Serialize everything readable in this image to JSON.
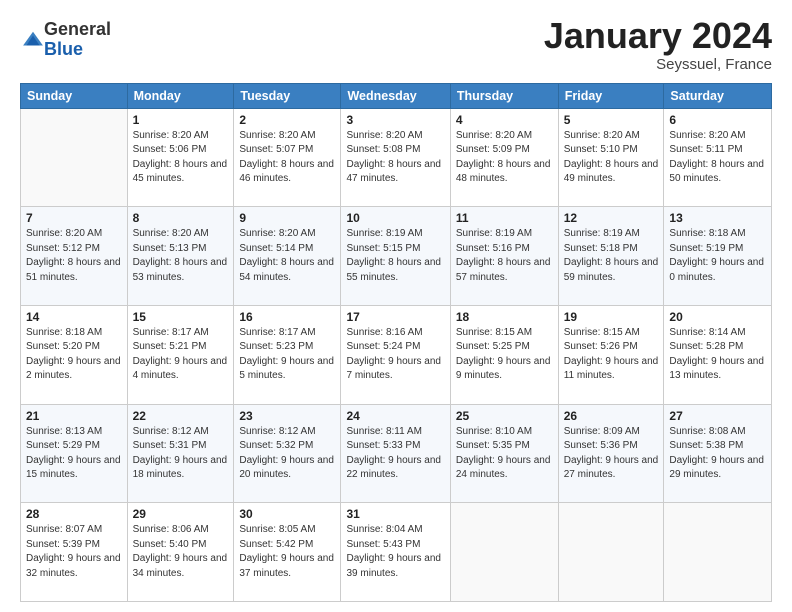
{
  "logo": {
    "general": "General",
    "blue": "Blue"
  },
  "title": "January 2024",
  "location": "Seyssuel, France",
  "days_header": [
    "Sunday",
    "Monday",
    "Tuesday",
    "Wednesday",
    "Thursday",
    "Friday",
    "Saturday"
  ],
  "weeks": [
    [
      {
        "day": "",
        "sunrise": "",
        "sunset": "",
        "daylight": ""
      },
      {
        "day": "1",
        "sunrise": "Sunrise: 8:20 AM",
        "sunset": "Sunset: 5:06 PM",
        "daylight": "Daylight: 8 hours and 45 minutes."
      },
      {
        "day": "2",
        "sunrise": "Sunrise: 8:20 AM",
        "sunset": "Sunset: 5:07 PM",
        "daylight": "Daylight: 8 hours and 46 minutes."
      },
      {
        "day": "3",
        "sunrise": "Sunrise: 8:20 AM",
        "sunset": "Sunset: 5:08 PM",
        "daylight": "Daylight: 8 hours and 47 minutes."
      },
      {
        "day": "4",
        "sunrise": "Sunrise: 8:20 AM",
        "sunset": "Sunset: 5:09 PM",
        "daylight": "Daylight: 8 hours and 48 minutes."
      },
      {
        "day": "5",
        "sunrise": "Sunrise: 8:20 AM",
        "sunset": "Sunset: 5:10 PM",
        "daylight": "Daylight: 8 hours and 49 minutes."
      },
      {
        "day": "6",
        "sunrise": "Sunrise: 8:20 AM",
        "sunset": "Sunset: 5:11 PM",
        "daylight": "Daylight: 8 hours and 50 minutes."
      }
    ],
    [
      {
        "day": "7",
        "sunrise": "Sunrise: 8:20 AM",
        "sunset": "Sunset: 5:12 PM",
        "daylight": "Daylight: 8 hours and 51 minutes."
      },
      {
        "day": "8",
        "sunrise": "Sunrise: 8:20 AM",
        "sunset": "Sunset: 5:13 PM",
        "daylight": "Daylight: 8 hours and 53 minutes."
      },
      {
        "day": "9",
        "sunrise": "Sunrise: 8:20 AM",
        "sunset": "Sunset: 5:14 PM",
        "daylight": "Daylight: 8 hours and 54 minutes."
      },
      {
        "day": "10",
        "sunrise": "Sunrise: 8:19 AM",
        "sunset": "Sunset: 5:15 PM",
        "daylight": "Daylight: 8 hours and 55 minutes."
      },
      {
        "day": "11",
        "sunrise": "Sunrise: 8:19 AM",
        "sunset": "Sunset: 5:16 PM",
        "daylight": "Daylight: 8 hours and 57 minutes."
      },
      {
        "day": "12",
        "sunrise": "Sunrise: 8:19 AM",
        "sunset": "Sunset: 5:18 PM",
        "daylight": "Daylight: 8 hours and 59 minutes."
      },
      {
        "day": "13",
        "sunrise": "Sunrise: 8:18 AM",
        "sunset": "Sunset: 5:19 PM",
        "daylight": "Daylight: 9 hours and 0 minutes."
      }
    ],
    [
      {
        "day": "14",
        "sunrise": "Sunrise: 8:18 AM",
        "sunset": "Sunset: 5:20 PM",
        "daylight": "Daylight: 9 hours and 2 minutes."
      },
      {
        "day": "15",
        "sunrise": "Sunrise: 8:17 AM",
        "sunset": "Sunset: 5:21 PM",
        "daylight": "Daylight: 9 hours and 4 minutes."
      },
      {
        "day": "16",
        "sunrise": "Sunrise: 8:17 AM",
        "sunset": "Sunset: 5:23 PM",
        "daylight": "Daylight: 9 hours and 5 minutes."
      },
      {
        "day": "17",
        "sunrise": "Sunrise: 8:16 AM",
        "sunset": "Sunset: 5:24 PM",
        "daylight": "Daylight: 9 hours and 7 minutes."
      },
      {
        "day": "18",
        "sunrise": "Sunrise: 8:15 AM",
        "sunset": "Sunset: 5:25 PM",
        "daylight": "Daylight: 9 hours and 9 minutes."
      },
      {
        "day": "19",
        "sunrise": "Sunrise: 8:15 AM",
        "sunset": "Sunset: 5:26 PM",
        "daylight": "Daylight: 9 hours and 11 minutes."
      },
      {
        "day": "20",
        "sunrise": "Sunrise: 8:14 AM",
        "sunset": "Sunset: 5:28 PM",
        "daylight": "Daylight: 9 hours and 13 minutes."
      }
    ],
    [
      {
        "day": "21",
        "sunrise": "Sunrise: 8:13 AM",
        "sunset": "Sunset: 5:29 PM",
        "daylight": "Daylight: 9 hours and 15 minutes."
      },
      {
        "day": "22",
        "sunrise": "Sunrise: 8:12 AM",
        "sunset": "Sunset: 5:31 PM",
        "daylight": "Daylight: 9 hours and 18 minutes."
      },
      {
        "day": "23",
        "sunrise": "Sunrise: 8:12 AM",
        "sunset": "Sunset: 5:32 PM",
        "daylight": "Daylight: 9 hours and 20 minutes."
      },
      {
        "day": "24",
        "sunrise": "Sunrise: 8:11 AM",
        "sunset": "Sunset: 5:33 PM",
        "daylight": "Daylight: 9 hours and 22 minutes."
      },
      {
        "day": "25",
        "sunrise": "Sunrise: 8:10 AM",
        "sunset": "Sunset: 5:35 PM",
        "daylight": "Daylight: 9 hours and 24 minutes."
      },
      {
        "day": "26",
        "sunrise": "Sunrise: 8:09 AM",
        "sunset": "Sunset: 5:36 PM",
        "daylight": "Daylight: 9 hours and 27 minutes."
      },
      {
        "day": "27",
        "sunrise": "Sunrise: 8:08 AM",
        "sunset": "Sunset: 5:38 PM",
        "daylight": "Daylight: 9 hours and 29 minutes."
      }
    ],
    [
      {
        "day": "28",
        "sunrise": "Sunrise: 8:07 AM",
        "sunset": "Sunset: 5:39 PM",
        "daylight": "Daylight: 9 hours and 32 minutes."
      },
      {
        "day": "29",
        "sunrise": "Sunrise: 8:06 AM",
        "sunset": "Sunset: 5:40 PM",
        "daylight": "Daylight: 9 hours and 34 minutes."
      },
      {
        "day": "30",
        "sunrise": "Sunrise: 8:05 AM",
        "sunset": "Sunset: 5:42 PM",
        "daylight": "Daylight: 9 hours and 37 minutes."
      },
      {
        "day": "31",
        "sunrise": "Sunrise: 8:04 AM",
        "sunset": "Sunset: 5:43 PM",
        "daylight": "Daylight: 9 hours and 39 minutes."
      },
      {
        "day": "",
        "sunrise": "",
        "sunset": "",
        "daylight": ""
      },
      {
        "day": "",
        "sunrise": "",
        "sunset": "",
        "daylight": ""
      },
      {
        "day": "",
        "sunrise": "",
        "sunset": "",
        "daylight": ""
      }
    ]
  ]
}
